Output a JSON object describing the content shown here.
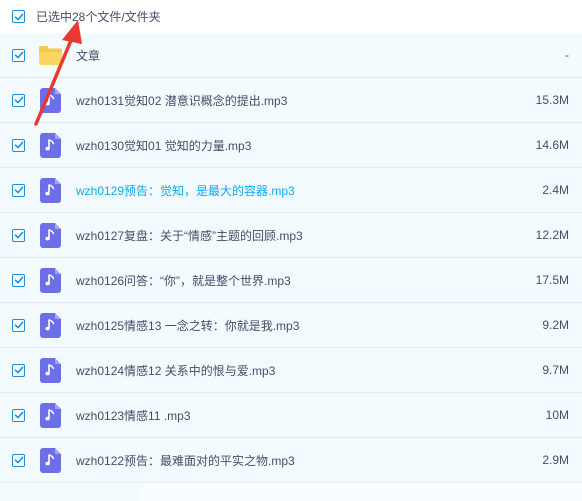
{
  "header": {
    "selection_text": "已选中28个文件/文件夹"
  },
  "files": [
    {
      "type": "folder",
      "icon": "folder-icon",
      "name": "文章",
      "size": "-",
      "active": false
    },
    {
      "type": "audio",
      "icon": "music-note-icon",
      "name": "wzh0131觉知02 潜意识概念的提出.mp3",
      "size": "15.3M",
      "active": false
    },
    {
      "type": "audio",
      "icon": "music-note-icon",
      "name": "wzh0130觉知01 觉知的力量.mp3",
      "size": "14.6M",
      "active": false
    },
    {
      "type": "audio",
      "icon": "music-note-icon",
      "name": "wzh0129预告：觉知，是最大的容器.mp3",
      "size": "2.4M",
      "active": true
    },
    {
      "type": "audio",
      "icon": "music-note-icon",
      "name": "wzh0127复盘：关于“情感”主题的回顾.mp3",
      "size": "12.2M",
      "active": false
    },
    {
      "type": "audio",
      "icon": "music-note-icon",
      "name": "wzh0126问答：“你”，就是整个世界.mp3",
      "size": "17.5M",
      "active": false
    },
    {
      "type": "audio",
      "icon": "music-note-icon",
      "name": "wzh0125情感13 一念之转：你就是我.mp3",
      "size": "9.2M",
      "active": false
    },
    {
      "type": "audio",
      "icon": "music-note-icon",
      "name": "wzh0124情感12 关系中的恨与爱.mp3",
      "size": "9.7M",
      "active": false
    },
    {
      "type": "audio",
      "icon": "music-note-icon",
      "name": "wzh0123情感11 .mp3",
      "size": "10M",
      "active": false
    },
    {
      "type": "audio",
      "icon": "music-note-icon",
      "name": "wzh0122预告：最难面对的平实之物.mp3",
      "size": "2.9M",
      "active": false
    }
  ],
  "colors": {
    "accent": "#1a8ddf",
    "active_text": "#09aaff",
    "audio_icon": "#6c6fe8",
    "folder": "#f7c84a",
    "annotation": "#e8382f"
  }
}
